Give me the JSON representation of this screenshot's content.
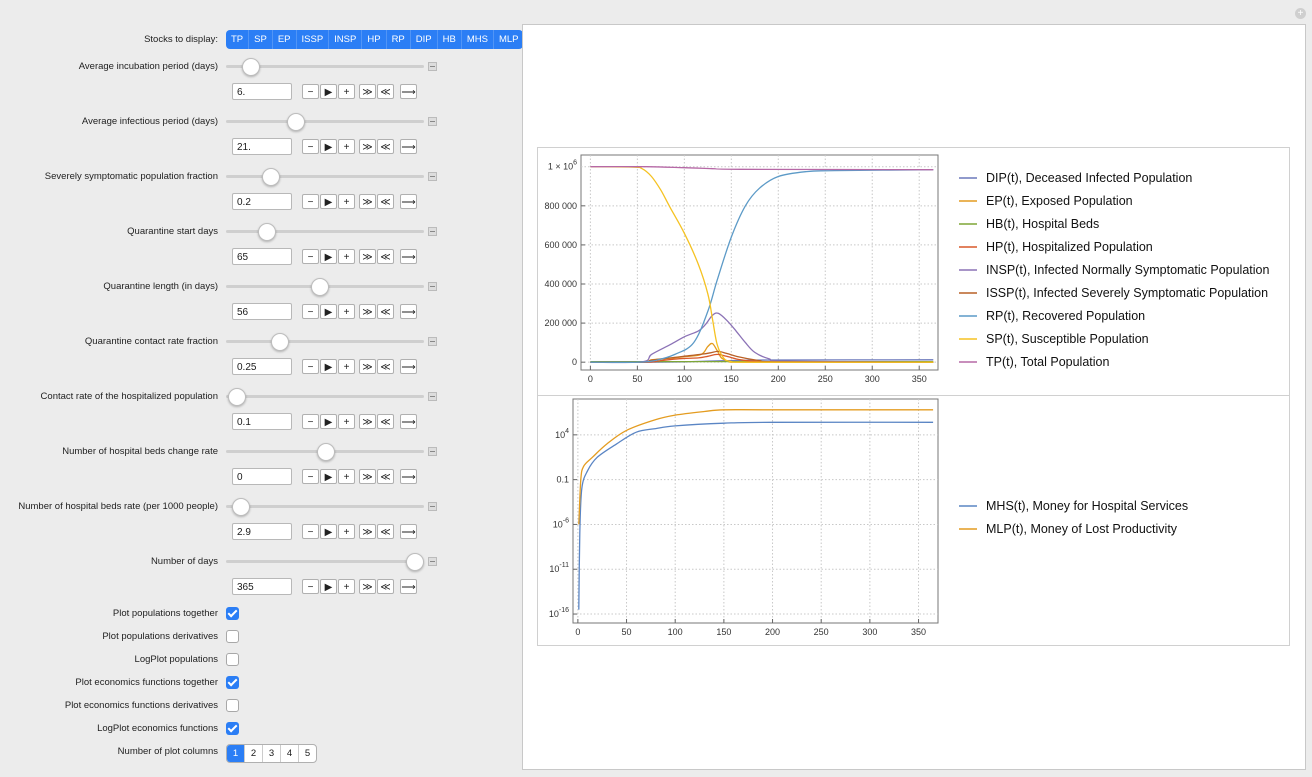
{
  "stocks": {
    "label": "Stocks to display:",
    "items": [
      "TP",
      "SP",
      "EP",
      "ISSP",
      "INSP",
      "HP",
      "RP",
      "DIP",
      "HB",
      "MHS",
      "MLP"
    ]
  },
  "sliders": [
    {
      "label": "Average incubation period (days)",
      "value": "6.",
      "level": 0.12
    },
    {
      "label": "Average infectious period (days)",
      "value": "21.",
      "level": 0.35
    },
    {
      "label": "Severely symptomatic population fraction",
      "value": "0.2",
      "level": 0.22
    },
    {
      "label": "Quarantine start days",
      "value": "65",
      "level": 0.2
    },
    {
      "label": "Quarantine length (in days)",
      "value": "56",
      "level": 0.47
    },
    {
      "label": "Quarantine contact rate fraction",
      "value": "0.25",
      "level": 0.27
    },
    {
      "label": "Contact rate of the hospitalized population",
      "value": "0.1",
      "level": 0.05
    },
    {
      "label": "Number of hospital beds change rate",
      "value": "0",
      "level": 0.5
    },
    {
      "label": "Number of hospital beds rate (per 1000 people)",
      "value": "2.9",
      "level": 0.07
    },
    {
      "label": "Number of days",
      "value": "365",
      "level": 0.95
    }
  ],
  "controls": {
    "minus": "−",
    "play": "▶",
    "plus": "+",
    "faster": "≫",
    "slower": "≪",
    "direction": "⟶"
  },
  "checkboxes": [
    {
      "label": "Plot populations together",
      "checked": true
    },
    {
      "label": "Plot populations derivatives",
      "checked": false
    },
    {
      "label": "LogPlot populations",
      "checked": false
    },
    {
      "label": "Plot economics functions together",
      "checked": true
    },
    {
      "label": "Plot economics functions derivatives",
      "checked": false
    },
    {
      "label": "LogPlot economics functions",
      "checked": true
    }
  ],
  "columns": {
    "label": "Number of plot columns",
    "options": [
      "1",
      "2",
      "3",
      "4",
      "5"
    ],
    "selected": "1"
  },
  "add_icon": "+",
  "chart_data": [
    {
      "type": "line",
      "title": "",
      "xlabel": "",
      "ylabel": "",
      "xlim": [
        -10,
        370
      ],
      "ylim": [
        -40000,
        1060000
      ],
      "x_ticks": [
        "0",
        "50",
        "100",
        "150",
        "200",
        "250",
        "300",
        "350"
      ],
      "y_ticks": [
        "0",
        "200 000",
        "400 000",
        "600 000",
        "800 000"
      ],
      "y_top_label": "1 × 10^6",
      "grid": "dotted",
      "legend_position": "right",
      "series": [
        {
          "name": "DIP(t), Deceased Infected Population",
          "color": "#6b78bb",
          "points": [
            [
              0,
              0
            ],
            [
              60,
              0
            ],
            [
              100,
              2000
            ],
            [
              130,
              6000
            ],
            [
              160,
              9000
            ],
            [
              200,
              11000
            ],
            [
              365,
              12000
            ]
          ]
        },
        {
          "name": "EP(t), Exposed Population",
          "color": "#e49c20",
          "points": [
            [
              0,
              0
            ],
            [
              55,
              1000
            ],
            [
              65,
              12000
            ],
            [
              80,
              18000
            ],
            [
              100,
              28000
            ],
            [
              118,
              40000
            ],
            [
              125,
              80000
            ],
            [
              130,
              95000
            ],
            [
              136,
              50000
            ],
            [
              140,
              20000
            ],
            [
              150,
              3000
            ],
            [
              170,
              0
            ],
            [
              365,
              0
            ]
          ]
        },
        {
          "name": "HB(t), Hospital Beds",
          "color": "#7ea637",
          "points": [
            [
              0,
              2900
            ],
            [
              365,
              2900
            ]
          ]
        },
        {
          "name": "HP(t), Hospitalized Population",
          "color": "#d9592a",
          "points": [
            [
              0,
              0
            ],
            [
              60,
              0
            ],
            [
              75,
              8000
            ],
            [
              95,
              18000
            ],
            [
              115,
              22000
            ],
            [
              125,
              30000
            ],
            [
              135,
              40000
            ],
            [
              145,
              30000
            ],
            [
              160,
              12000
            ],
            [
              180,
              3000
            ],
            [
              200,
              500
            ],
            [
              365,
              0
            ]
          ]
        },
        {
          "name": "INSP(t), Infected Normally Symptomatic Population",
          "color": "#8b72b6",
          "points": [
            [
              0,
              0
            ],
            [
              55,
              2000
            ],
            [
              65,
              40000
            ],
            [
              85,
              90000
            ],
            [
              100,
              130000
            ],
            [
              115,
              160000
            ],
            [
              122,
              190000
            ],
            [
              130,
              240000
            ],
            [
              136,
              250000
            ],
            [
              145,
              215000
            ],
            [
              155,
              160000
            ],
            [
              165,
              100000
            ],
            [
              175,
              50000
            ],
            [
              190,
              18000
            ],
            [
              210,
              5000
            ],
            [
              365,
              0
            ]
          ]
        },
        {
          "name": "ISSP(t), Infected Severely Symptomatic Population",
          "color": "#b86026",
          "points": [
            [
              0,
              0
            ],
            [
              55,
              500
            ],
            [
              65,
              10000
            ],
            [
              85,
              22000
            ],
            [
              105,
              33000
            ],
            [
              120,
              42000
            ],
            [
              128,
              48000
            ],
            [
              136,
              55000
            ],
            [
              145,
              45000
            ],
            [
              160,
              25000
            ],
            [
              180,
              8000
            ],
            [
              200,
              2000
            ],
            [
              365,
              0
            ]
          ]
        },
        {
          "name": "RP(t), Recovered Population",
          "color": "#5c9ac7",
          "points": [
            [
              0,
              0
            ],
            [
              50,
              0
            ],
            [
              70,
              10000
            ],
            [
              90,
              40000
            ],
            [
              110,
              100000
            ],
            [
              125,
              260000
            ],
            [
              135,
              420000
            ],
            [
              150,
              640000
            ],
            [
              165,
              800000
            ],
            [
              180,
              890000
            ],
            [
              200,
              950000
            ],
            [
              230,
              975000
            ],
            [
              260,
              980000
            ],
            [
              365,
              985000
            ]
          ]
        },
        {
          "name": "SP(t), Susceptible Population",
          "color": "#f5c222",
          "points": [
            [
              0,
              1000000
            ],
            [
              45,
              998000
            ],
            [
              55,
              990000
            ],
            [
              65,
              950000
            ],
            [
              75,
              880000
            ],
            [
              85,
              790000
            ],
            [
              100,
              660000
            ],
            [
              115,
              500000
            ],
            [
              125,
              350000
            ],
            [
              130,
              220000
            ],
            [
              135,
              90000
            ],
            [
              142,
              20000
            ],
            [
              150,
              3000
            ],
            [
              170,
              0
            ],
            [
              365,
              0
            ]
          ]
        },
        {
          "name": "TP(t), Total Population",
          "color": "#b668a6",
          "points": [
            [
              0,
              1000000
            ],
            [
              60,
              1000000
            ],
            [
              100,
              995000
            ],
            [
              130,
              990000
            ],
            [
              160,
              987000
            ],
            [
              365,
              985000
            ]
          ]
        }
      ]
    },
    {
      "type": "line",
      "title": "",
      "xlabel": "",
      "ylabel": "",
      "log_y": true,
      "xlim": [
        -5,
        370
      ],
      "ylim_log10": [
        -17,
        8
      ],
      "x_ticks": [
        "0",
        "50",
        "100",
        "150",
        "200",
        "250",
        "300",
        "350"
      ],
      "y_ticks": [
        "10^4",
        "0.1",
        "10^-6",
        "10^-11",
        "10^-16"
      ],
      "grid": "dotted",
      "legend_position": "right",
      "series": [
        {
          "name": "MHS(t), Money for Hospital Services",
          "color": "#5a85c4",
          "points_log10": [
            [
              1,
              -15.5
            ],
            [
              2,
              -7
            ],
            [
              4,
              -2
            ],
            [
              10,
              0
            ],
            [
              20,
              1.5
            ],
            [
              40,
              3
            ],
            [
              60,
              4.3
            ],
            [
              80,
              4.7
            ],
            [
              100,
              5
            ],
            [
              150,
              5.3
            ],
            [
              200,
              5.4
            ],
            [
              365,
              5.4
            ]
          ]
        },
        {
          "name": "MLP(t), Money of Lost Productivity",
          "color": "#e49c20",
          "points_log10": [
            [
              1,
              -6
            ],
            [
              3,
              -1
            ],
            [
              6,
              0.5
            ],
            [
              15,
              1.5
            ],
            [
              30,
              3
            ],
            [
              50,
              4.5
            ],
            [
              80,
              5.7
            ],
            [
              100,
              6.2
            ],
            [
              130,
              6.6
            ],
            [
              150,
              6.8
            ],
            [
              200,
              6.8
            ],
            [
              365,
              6.8
            ]
          ]
        }
      ]
    }
  ]
}
